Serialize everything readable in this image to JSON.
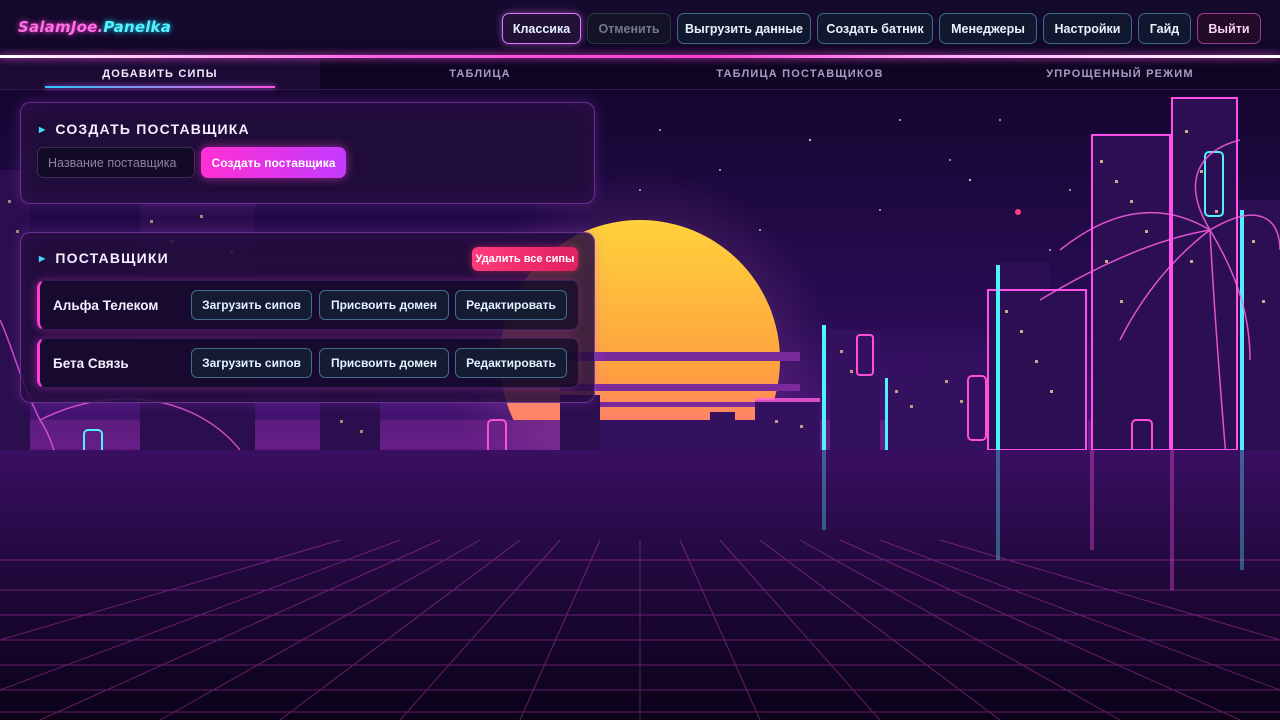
{
  "app": {
    "brand_part1": "SalamJoe.",
    "brand_part2": "Panelka"
  },
  "header": {
    "buttons": [
      {
        "label": "Классика",
        "state": "active"
      },
      {
        "label": "Отменить",
        "state": "disabled"
      },
      {
        "label": "Выгрузить данные",
        "state": "normal"
      },
      {
        "label": "Создать батник",
        "state": "normal"
      },
      {
        "label": "Менеджеры",
        "state": "normal"
      },
      {
        "label": "Настройки",
        "state": "normal"
      },
      {
        "label": "Гайд",
        "state": "normal"
      },
      {
        "label": "Выйти",
        "state": "logout"
      }
    ]
  },
  "tabs": [
    {
      "label": "ДОБАВИТЬ СИПЫ",
      "active": true
    },
    {
      "label": "ТАБЛИЦА",
      "active": false
    },
    {
      "label": "ТАБЛИЦА ПОСТАВЩИКОВ",
      "active": false
    },
    {
      "label": "УПРОЩЕННЫЙ РЕЖИМ",
      "active": false
    }
  ],
  "create_provider": {
    "title": "СОЗДАТЬ ПОСТАВЩИКА",
    "input_placeholder": "Название поставщика",
    "input_value": "",
    "button_label": "Создать поставщика"
  },
  "providers": {
    "title": "ПОСТАВЩИКИ",
    "delete_all_label": "Удалить все сипы",
    "items": [
      {
        "name": "Альфа Телеком",
        "actions": [
          "Загрузить сипов",
          "Присвоить домен",
          "Редактировать"
        ]
      },
      {
        "name": "Бета Связь",
        "actions": [
          "Загрузить сипов",
          "Присвоить домен",
          "Редактировать"
        ]
      }
    ]
  },
  "colors": {
    "accent_pink": "#ff3fd4",
    "accent_cyan": "#3fd8ff",
    "danger": "#ff3b7b",
    "sun_top": "#ffd23a",
    "sun_bottom": "#ff4fb0"
  }
}
